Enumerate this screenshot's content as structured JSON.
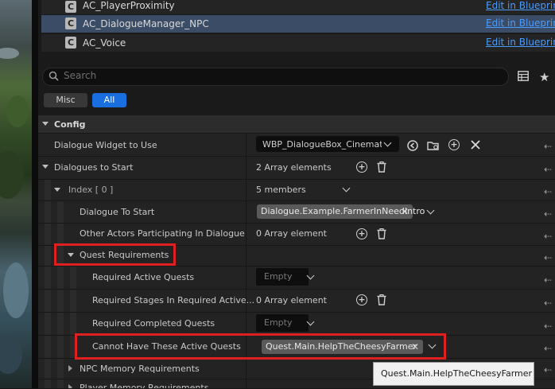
{
  "components": [
    {
      "name": "AC_PlayerProximity",
      "link": "Edit in Blueprint",
      "selected": false
    },
    {
      "name": "AC_DialogueManager_NPC",
      "link": "Edit in Blueprint",
      "selected": true
    },
    {
      "name": "AC_Voice",
      "link": "Edit in Blueprint",
      "selected": false
    }
  ],
  "search": {
    "placeholder": "Search"
  },
  "filters": {
    "misc": "Misc",
    "all": "All"
  },
  "section": {
    "title": "Config"
  },
  "properties": {
    "dialogue_widget": {
      "label": "Dialogue Widget to Use",
      "value": "WBP_DialogueBox_Cinematic"
    },
    "dialogues_to_start": {
      "label": "Dialogues to Start",
      "value": "2 Array elements"
    },
    "index0": {
      "label": "Index [ 0 ]",
      "value": "5 members"
    },
    "dialogue_to_start": {
      "label": "Dialogue To Start",
      "value": "Dialogue.Example.FarmerInNeedIntro"
    },
    "other_actors": {
      "label": "Other Actors Participating In Dialogue",
      "value": "0 Array element"
    },
    "quest_requirements": {
      "label": "Quest Requirements"
    },
    "required_active": {
      "label": "Required Active Quests",
      "value": "Empty"
    },
    "required_stages": {
      "label": "Required Stages In Required Active...",
      "value": "0 Array element"
    },
    "required_completed": {
      "label": "Required Completed Quests",
      "value": "Empty"
    },
    "cannot_have": {
      "label": "Cannot Have These Active Quests",
      "value": "Quest.Main.HelpTheCheesyFarmer"
    },
    "npc_memory": {
      "label": "NPC Memory Requirements"
    },
    "player_memory": {
      "label": "Player Memory Requirements"
    }
  },
  "tooltip": {
    "text": "Quest.Main.HelpTheCheesyFarmer"
  },
  "colors": {
    "accent": "#1a6fe0",
    "selected_row": "#3b4d66",
    "highlight_box": "#e02020",
    "link": "#4a9cff"
  }
}
